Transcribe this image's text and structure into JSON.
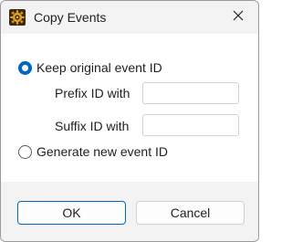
{
  "window": {
    "title": "Copy Events",
    "app_icon": "gear-sun-icon",
    "close_icon": "close-icon"
  },
  "options": {
    "keep_original": {
      "label": "Keep original event ID",
      "selected": true
    },
    "prefix": {
      "label": "Prefix ID with",
      "value": ""
    },
    "suffix": {
      "label": "Suffix ID with",
      "value": ""
    },
    "generate_new": {
      "label": "Generate new event ID",
      "selected": false
    }
  },
  "buttons": {
    "ok_label": "OK",
    "cancel_label": "Cancel"
  },
  "colors": {
    "accent": "#0067c0",
    "dialog_bg": "#f3f3f3",
    "content_bg": "#ffffff"
  }
}
